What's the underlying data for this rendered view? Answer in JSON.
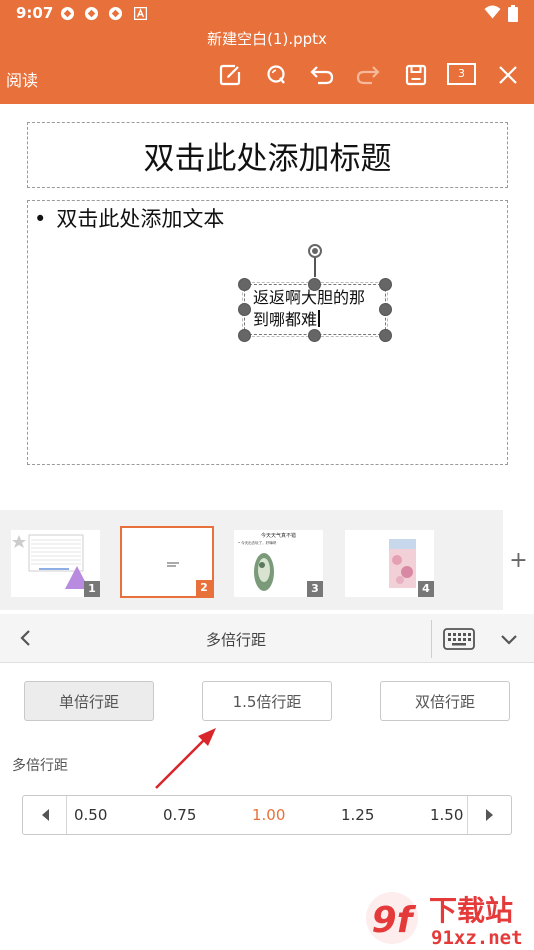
{
  "status_bar": {
    "time": "9:07"
  },
  "header": {
    "doc_title": "新建空白(1).pptx",
    "read_mode_label": "阅读",
    "page_count": "3"
  },
  "slide": {
    "title_placeholder": "双击此处添加标题",
    "body_placeholder": "双击此处添加文本",
    "bullet": "•",
    "textbox_line1": "返返啊大胆的那",
    "textbox_line2": "到哪都难"
  },
  "thumbnails": {
    "items": [
      {
        "num": "1"
      },
      {
        "num": "2"
      },
      {
        "num": "3",
        "title": "今天天气真不错",
        "bullet": "• 今天出去玩了，好嗨呀"
      },
      {
        "num": "4"
      }
    ],
    "add_label": "+"
  },
  "panel": {
    "title": "多倍行距",
    "buttons": {
      "single": "单倍行距",
      "one_half": "1.5倍行距",
      "double": "双倍行距"
    },
    "section_label": "多倍行距",
    "values": [
      "0.50",
      "0.75",
      "1.00",
      "1.25",
      "1.50"
    ],
    "selected_value": "1.00"
  },
  "colors": {
    "accent": "#E8703A",
    "annotation_arrow": "#D9262A"
  },
  "watermark": {
    "logo_text": "9f",
    "brand": "下载站",
    "domain": "91xz.net"
  }
}
